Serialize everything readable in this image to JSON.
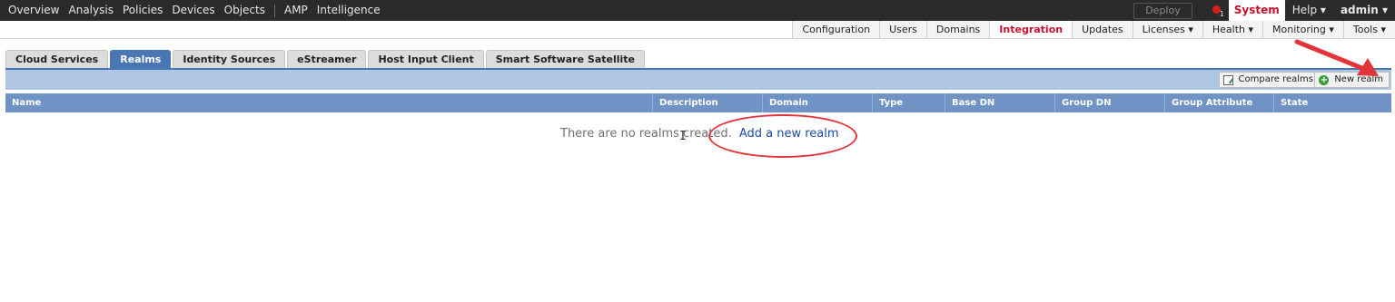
{
  "topnav": {
    "items": [
      "Overview",
      "Analysis",
      "Policies",
      "Devices",
      "Objects",
      "AMP",
      "Intelligence"
    ],
    "deploy_label": "Deploy",
    "alert_count": "1",
    "system_label": "System",
    "help_label": "Help ▾",
    "admin_label": "admin ▾"
  },
  "subnav": {
    "items": [
      "Configuration",
      "Users",
      "Domains",
      "Integration",
      "Updates",
      "Licenses ▾",
      "Health ▾",
      "Monitoring ▾",
      "Tools ▾"
    ],
    "active": "Integration"
  },
  "tabs": {
    "items": [
      "Cloud Services",
      "Realms",
      "Identity Sources",
      "eStreamer",
      "Host Input Client",
      "Smart Software Satellite"
    ],
    "active": "Realms"
  },
  "toolbar": {
    "compare_label": "Compare realms",
    "new_realm_label": "New realm"
  },
  "table": {
    "columns": [
      "Name",
      "Description",
      "Domain",
      "Type",
      "Base DN",
      "Group DN",
      "Group Attribute",
      "State"
    ]
  },
  "empty_state": {
    "message": "There are no realms created.",
    "link_label": "Add a new realm"
  },
  "colors": {
    "active_red": "#c8102e",
    "tab_blue": "#4a77b4",
    "header_blue": "#6f93c5",
    "annotation_red": "#e2343a"
  }
}
